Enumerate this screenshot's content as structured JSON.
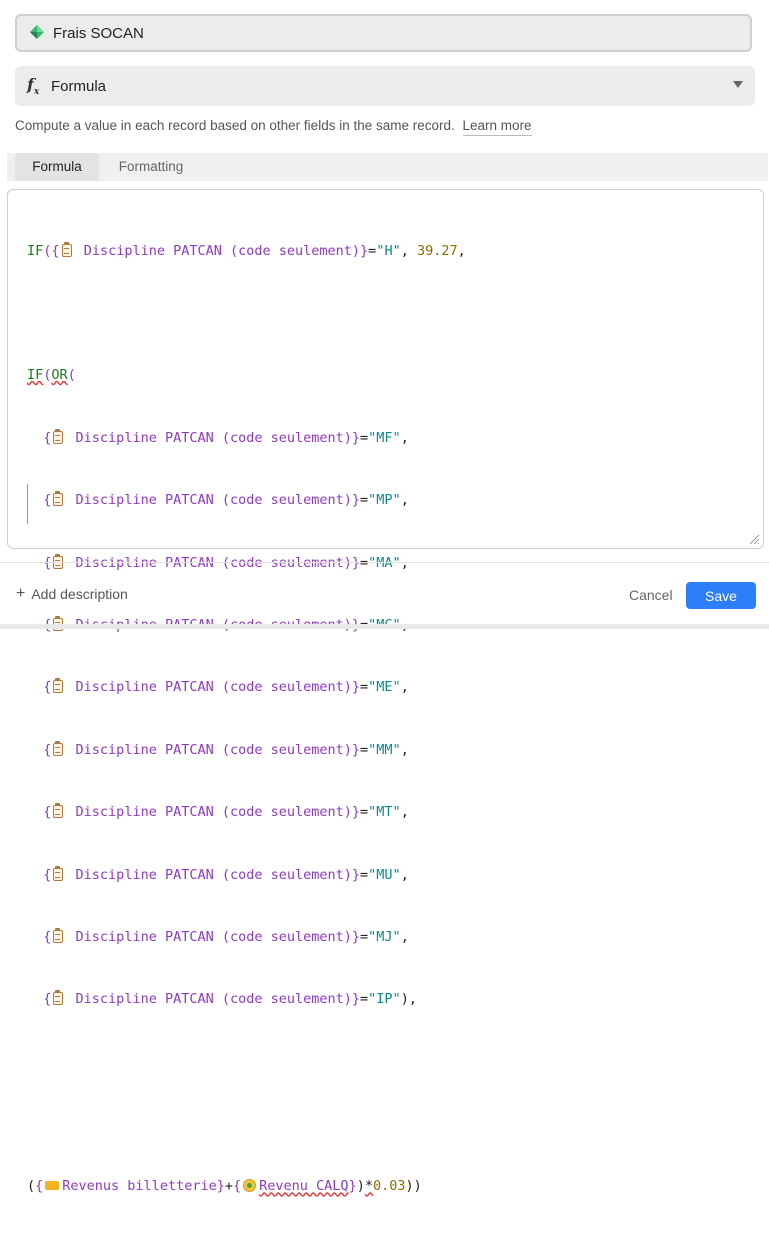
{
  "field": {
    "name": "Frais SOCAN",
    "icon": "gem-icon"
  },
  "type_select": {
    "label": "Formula",
    "icon": "fx-icon"
  },
  "help": {
    "text": "Compute a value in each record based on other fields in the same record.",
    "link": "Learn more"
  },
  "tabs": [
    {
      "label": "Formula",
      "active": true
    },
    {
      "label": "Formatting",
      "active": false
    }
  ],
  "formula": {
    "if_kw": "IF",
    "or_kw": "OR",
    "open_brace": "{",
    "close_brace": "}",
    "discipline_field": "Discipline PATCAN (code seulement)",
    "first_value": "\"H\"",
    "first_result": "39.27",
    "or_values": [
      "\"MF\"",
      "\"MP\"",
      "\"MA\"",
      "\"MC\"",
      "\"ME\"",
      "\"MM\"",
      "\"MT\"",
      "\"MU\"",
      "\"MJ\"",
      "\"IP\""
    ],
    "revenue_field_1": "Revenus billetterie",
    "revenue_field_2": "Revenu CALQ",
    "multiplier": "0.03"
  },
  "footer": {
    "add_description": "Add description",
    "cancel": "Cancel",
    "save": "Save"
  },
  "colors": {
    "accent": "#2d7ff9",
    "keyword": "#1f7a1f",
    "field": "#8e3bbd",
    "string": "#0b8a8a",
    "number": "#8a6d00"
  }
}
